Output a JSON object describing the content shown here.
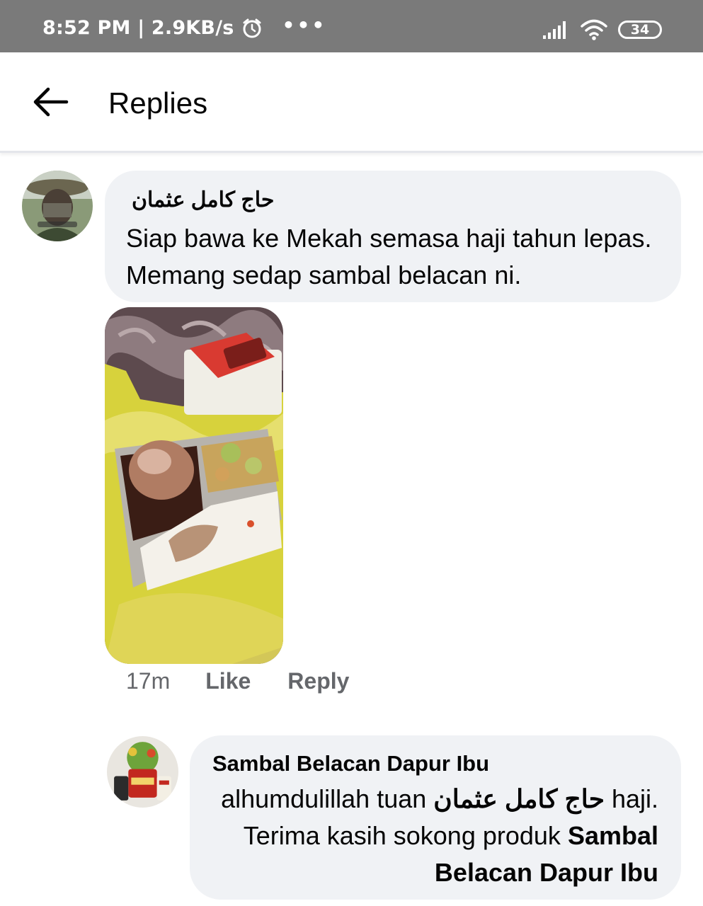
{
  "status_bar": {
    "time_speed": "8:52 PM | 2.9KB/s",
    "more_dots": "•••",
    "battery": "34"
  },
  "header": {
    "title": "Replies"
  },
  "comment": {
    "author": "حاج كامل عثمان",
    "text": "Siap bawa ke Mekah semasa haji  tahun lepas. Memang sedap sambal belacan ni.",
    "time": "17m",
    "like_label": "Like",
    "reply_label": "Reply"
  },
  "reply": {
    "author": "Sambal Belacan Dapur Ibu",
    "text_part1": "alhumdulillah tuan ",
    "mention": "حاج كامل عثمان",
    "text_part2": " haji. Terima kasih sokong produk ",
    "page_mention": "Sambal Belacan Dapur Ibu"
  },
  "colors": {
    "status_bar_bg": "#7a7a7a",
    "bubble_bg": "#f0f2f5",
    "meta_text": "#65676b"
  }
}
